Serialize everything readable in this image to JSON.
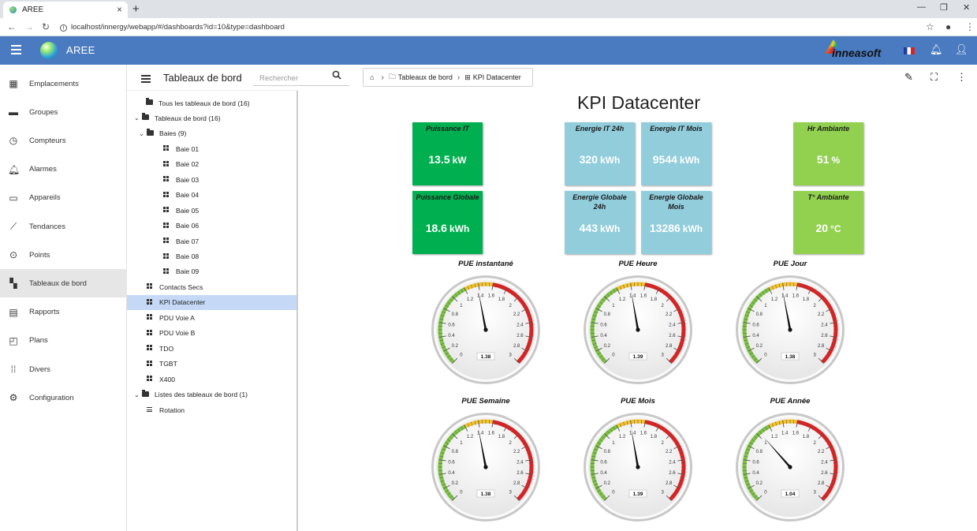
{
  "browser": {
    "tab_title": "AREE",
    "url": "localhost/innergy/webapp/#/dashboards?id=10&type=dashboard"
  },
  "app": {
    "title": "AREE",
    "brand": "inneasoft"
  },
  "leftnav": [
    {
      "label": "Emplacements",
      "icon": "location-icon"
    },
    {
      "label": "Groupes",
      "icon": "folder-icon"
    },
    {
      "label": "Compteurs",
      "icon": "meter-icon"
    },
    {
      "label": "Alarmes",
      "icon": "bell-icon"
    },
    {
      "label": "Appareils",
      "icon": "devices-icon"
    },
    {
      "label": "Tendances",
      "icon": "trend-icon"
    },
    {
      "label": "Points",
      "icon": "points-icon"
    },
    {
      "label": "Tableaux de bord",
      "icon": "dashboard-icon",
      "active": true
    },
    {
      "label": "Rapports",
      "icon": "report-icon"
    },
    {
      "label": "Plans",
      "icon": "plan-icon"
    },
    {
      "label": "Divers",
      "icon": "apps-icon"
    },
    {
      "label": "Configuration",
      "icon": "gear-icon"
    }
  ],
  "panel": {
    "title": "Tableaux de bord",
    "search_placeholder": "Rechercher"
  },
  "tree": [
    {
      "label": "Tous les tableaux de bord (16)",
      "level": 1,
      "type": "folder",
      "chevron": false
    },
    {
      "label": "Tableaux de bord (16)",
      "level": 0,
      "type": "folder",
      "chevron": true
    },
    {
      "label": "Baies (9)",
      "level": 1,
      "type": "folder",
      "chevron": true
    },
    {
      "label": "Baie 01",
      "level": 2,
      "type": "dash"
    },
    {
      "label": "Baie 02",
      "level": 2,
      "type": "dash"
    },
    {
      "label": "Baie 03",
      "level": 2,
      "type": "dash"
    },
    {
      "label": "Baie 04",
      "level": 2,
      "type": "dash"
    },
    {
      "label": "Baie 05",
      "level": 2,
      "type": "dash"
    },
    {
      "label": "Baie 06",
      "level": 2,
      "type": "dash"
    },
    {
      "label": "Baie 07",
      "level": 2,
      "type": "dash"
    },
    {
      "label": "Baie 08",
      "level": 2,
      "type": "dash"
    },
    {
      "label": "Baie 09",
      "level": 2,
      "type": "dash"
    },
    {
      "label": "Contacts Secs",
      "level": 1,
      "type": "dash"
    },
    {
      "label": "KPI Datacenter",
      "level": 1,
      "type": "dash",
      "selected": true
    },
    {
      "label": "PDU Voie A",
      "level": 1,
      "type": "dash"
    },
    {
      "label": "PDU Voie B",
      "level": 1,
      "type": "dash"
    },
    {
      "label": "TDO",
      "level": 1,
      "type": "dash"
    },
    {
      "label": "TGBT",
      "level": 1,
      "type": "dash"
    },
    {
      "label": "X400",
      "level": 1,
      "type": "dash"
    },
    {
      "label": "Listes des tableaux de bord (1)",
      "level": 0,
      "type": "folder",
      "chevron": true
    },
    {
      "label": "Rotation",
      "level": 1,
      "type": "list"
    }
  ],
  "breadcrumb": {
    "root": "Tableaux de bord",
    "current": "KPI Datacenter"
  },
  "dashboard": {
    "title": "KPI Datacenter",
    "tiles": [
      {
        "label": "Puissance IT",
        "value": "13.5",
        "unit": "kW",
        "color": "#00b050"
      },
      {
        "label": "Energie IT 24h",
        "value": "320",
        "unit": "kWh",
        "color": "#92cddc"
      },
      {
        "label": "Energie IT Mois",
        "value": "9544",
        "unit": "kWh",
        "color": "#92cddc"
      },
      {
        "label": "Hr Ambiante",
        "value": "51",
        "unit": "%",
        "color": "#92d050"
      },
      {
        "label": "Puissance Globale",
        "value": "18.6",
        "unit": "kWh",
        "color": "#00b050"
      },
      {
        "label": "Energie Globale 24h",
        "value": "443",
        "unit": "kWh",
        "color": "#92cddc"
      },
      {
        "label": "Energie Globale Mois",
        "value": "13286",
        "unit": "kWh",
        "color": "#92cddc"
      },
      {
        "label": "T° Ambiante",
        "value": "20",
        "unit": "°C",
        "color": "#92d050"
      }
    ],
    "gauge_scale": {
      "min": 0,
      "max": 3,
      "ticks": [
        "0",
        "0.2",
        "0.4",
        "0.6",
        "0.8",
        "1",
        "1.2",
        "1.4",
        "1.6",
        "1.8",
        "2",
        "2.2",
        "2.4",
        "2.6",
        "2.8",
        "3"
      ],
      "zones": [
        {
          "from": 0,
          "to": 1.2,
          "color": "#7cc142"
        },
        {
          "from": 1.2,
          "to": 1.6,
          "color": "#f2c12e"
        },
        {
          "from": 1.6,
          "to": 3,
          "color": "#e02020"
        }
      ]
    },
    "gauges": [
      {
        "title": "PUE instantané",
        "value": 1.38,
        "display": "1.38"
      },
      {
        "title": "PUE Heure",
        "value": 1.39,
        "display": "1.39"
      },
      {
        "title": "PUE Jour",
        "value": 1.38,
        "display": "1.38"
      },
      {
        "title": "PUE Semaine",
        "value": 1.38,
        "display": "1.38"
      },
      {
        "title": "PUE Mois",
        "value": 1.39,
        "display": "1.39"
      },
      {
        "title": "PUE Année",
        "value": 1.04,
        "display": "1.04"
      }
    ]
  }
}
